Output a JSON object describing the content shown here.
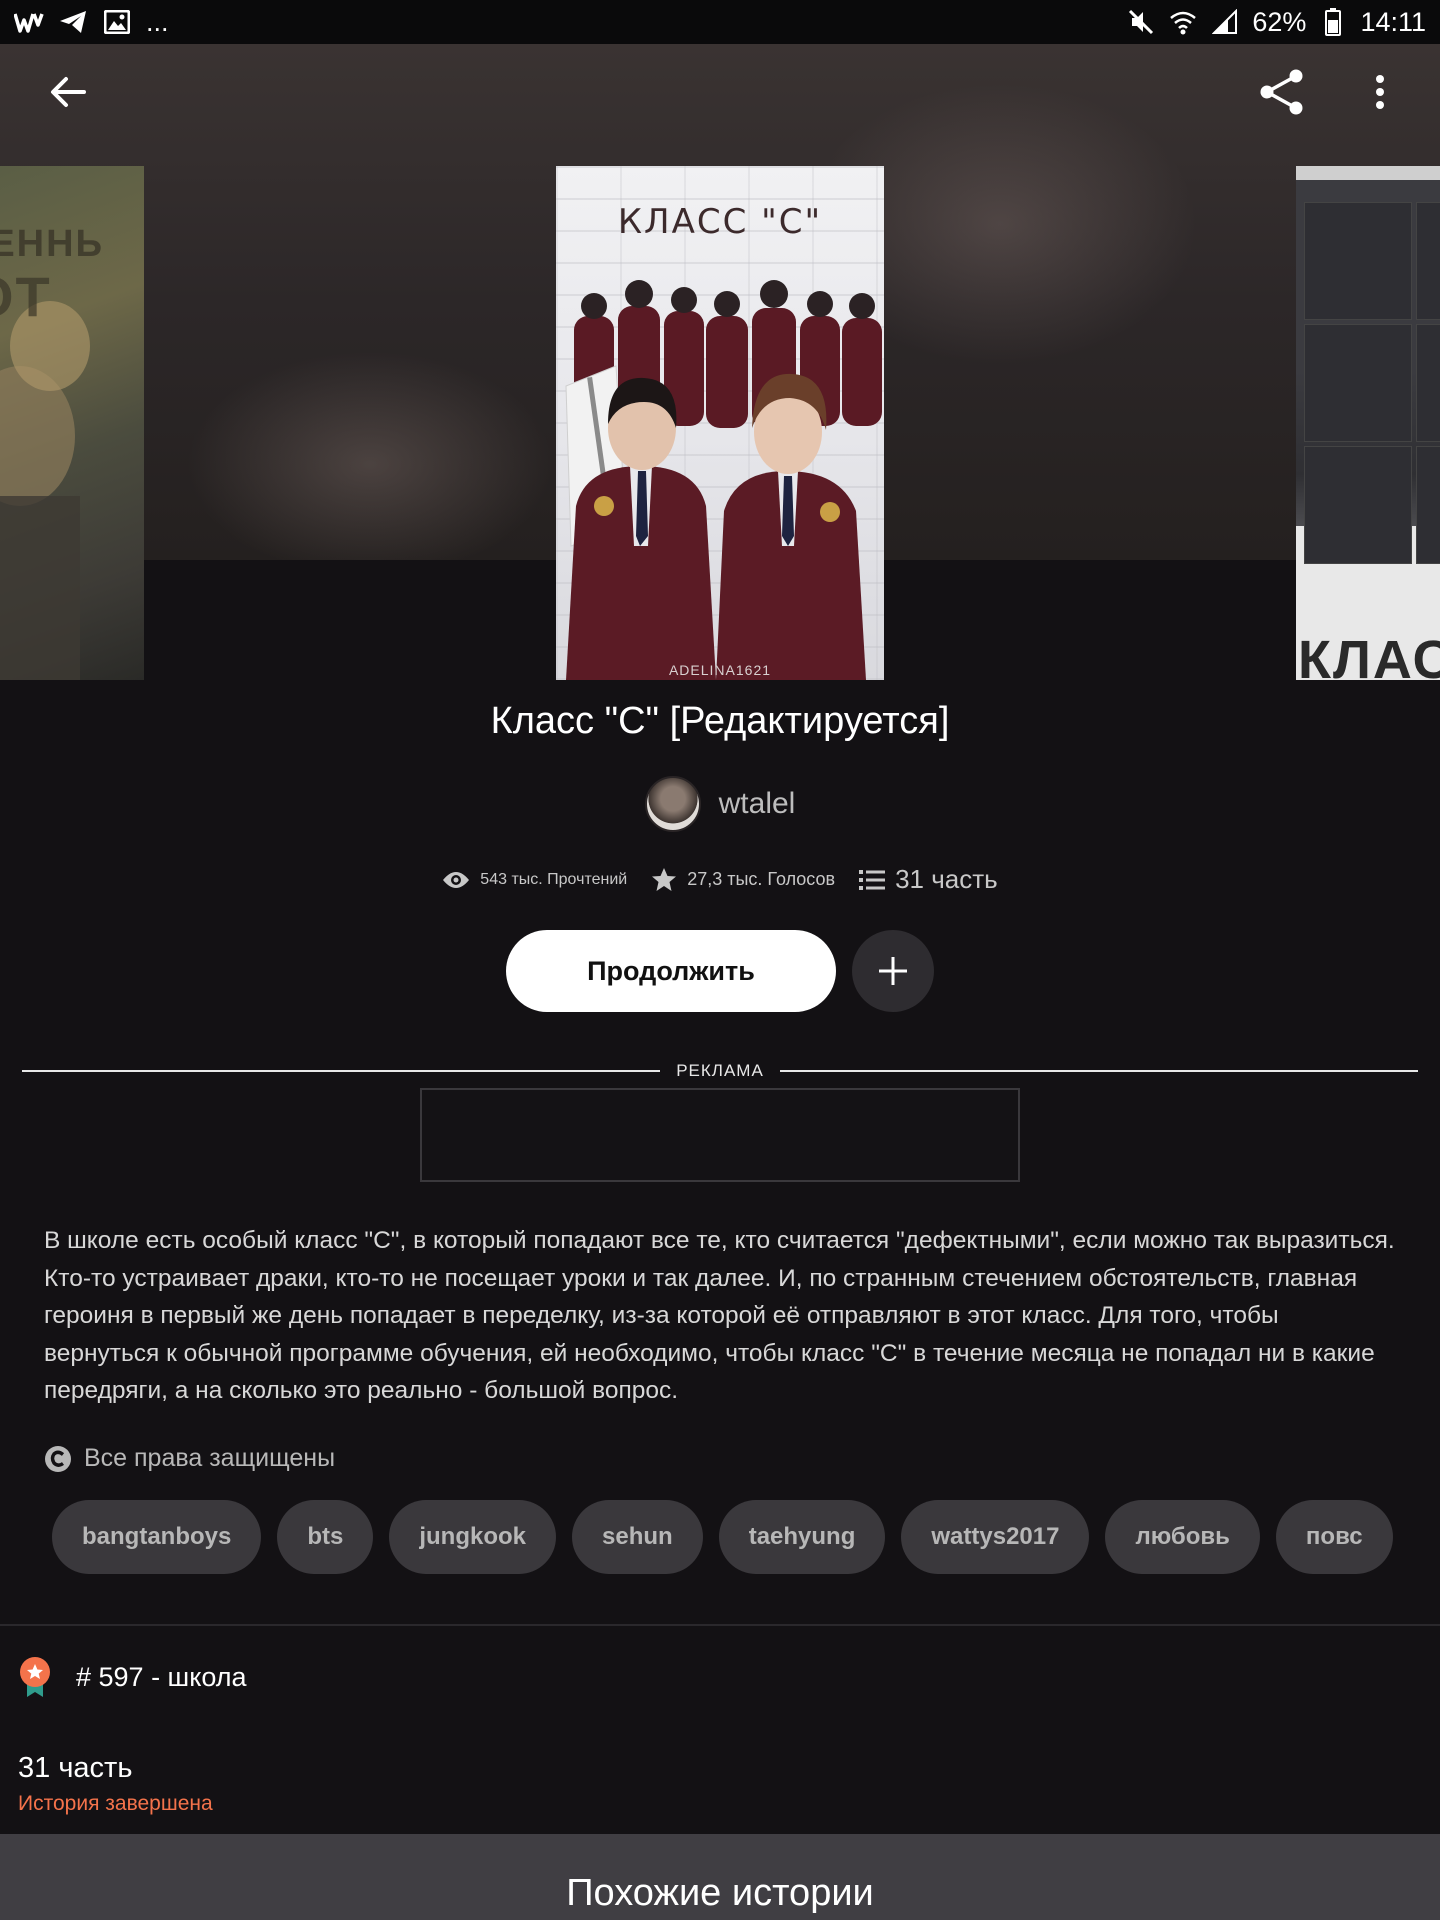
{
  "status_bar": {
    "left_icons": [
      "wattpad-icon",
      "telegram-icon",
      "gallery-icon"
    ],
    "more": "...",
    "battery_percent": "62%",
    "time": "14:11"
  },
  "toolbar": {
    "back_icon": "arrow-left-icon",
    "share_icon": "share-icon",
    "more_icon": "more-vertical-icon"
  },
  "cover": {
    "title": "КЛАСС \"С\"",
    "credit": "ADELINA1621"
  },
  "story": {
    "title": "Класс \"С\" [Редактируется]",
    "author": "wtalel",
    "reads": "543 тыс. Прочтений",
    "votes": "27,3 тыс. Голосов",
    "parts": "31 часть",
    "continue_label": "Продолжить"
  },
  "ad": {
    "label": "РЕКЛАМА"
  },
  "description": "В школе есть особый класс \"С\", в который попадают все те, кто считается \"дефектными\", если можно так выразиться. Кто-то устраивает драки, кто-то не посещает уроки и так далее. И, по странным стечением обстоятельств, главная героиня в первый же день попадает в переделку, из-за которой её отправляют в этот класс. Для того, чтобы вернуться к обычной программе обучения, ей необходимо, чтобы класс \"С\" в течение месяца не попадал ни в какие передряги, а на сколько это реально - большой вопрос.",
  "rights": "Все права защищены",
  "tags": [
    "bangtanboys",
    "bts",
    "jungkook",
    "sehun",
    "taehyung",
    "wattys2017",
    "любовь",
    "повс"
  ],
  "ranking": {
    "text": "# 597 - школа"
  },
  "parts_info": {
    "count": "31 часть",
    "status": "История завершена"
  },
  "similar": {
    "title": "Похожие истории"
  },
  "colors": {
    "accent": "#f4734b",
    "background": "#131114",
    "tag_bg": "#3a383c"
  }
}
